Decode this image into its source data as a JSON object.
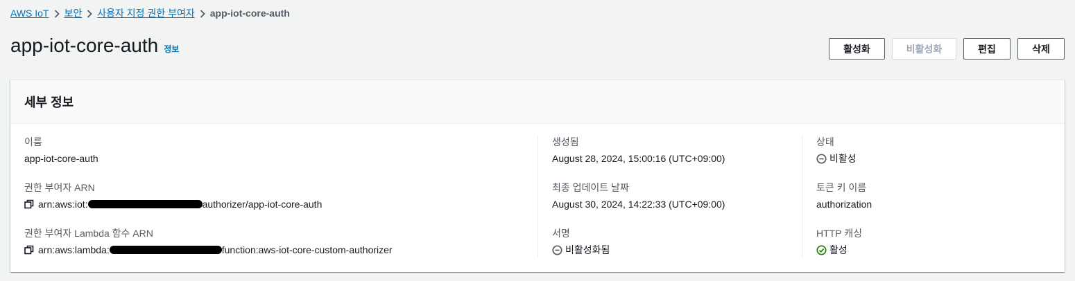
{
  "breadcrumb": {
    "items": [
      "AWS IoT",
      "보안",
      "사용자 지정 권한 부여자"
    ],
    "current": "app-iot-core-auth"
  },
  "header": {
    "title": "app-iot-core-auth",
    "info_label": "정보"
  },
  "actions": {
    "activate": "활성화",
    "deactivate": "비활성화",
    "edit": "편집",
    "delete": "삭제"
  },
  "details": {
    "title": "세부 정보",
    "name_label": "이름",
    "name_value": "app-iot-core-auth",
    "arn_label": "권한 부여자 ARN",
    "arn_prefix": "arn:aws:iot:",
    "arn_suffix": "authorizer/app-iot-core-auth",
    "lambda_arn_label": "권한 부여자 Lambda 함수 ARN",
    "lambda_arn_prefix": "arn:aws:lambda:",
    "lambda_arn_suffix": "function:aws-iot-core-custom-authorizer",
    "created_label": "생성됨",
    "created_value": "August 28, 2024, 15:00:16 (UTC+09:00)",
    "updated_label": "최종 업데이트 날짜",
    "updated_value": "August 30, 2024, 14:22:33 (UTC+09:00)",
    "signing_label": "서명",
    "signing_value": "비활성화됨",
    "status_label": "상태",
    "status_value": "비활성",
    "token_key_label": "토큰 키 이름",
    "token_key_value": "authorization",
    "http_cache_label": "HTTP 캐싱",
    "http_cache_value": "활성"
  },
  "colors": {
    "link": "#0073bb",
    "success": "#1d8102",
    "muted": "#545b64"
  },
  "icons": {
    "copy": "copy-icon",
    "inactive": "minus-circle-icon",
    "active": "check-circle-icon"
  }
}
